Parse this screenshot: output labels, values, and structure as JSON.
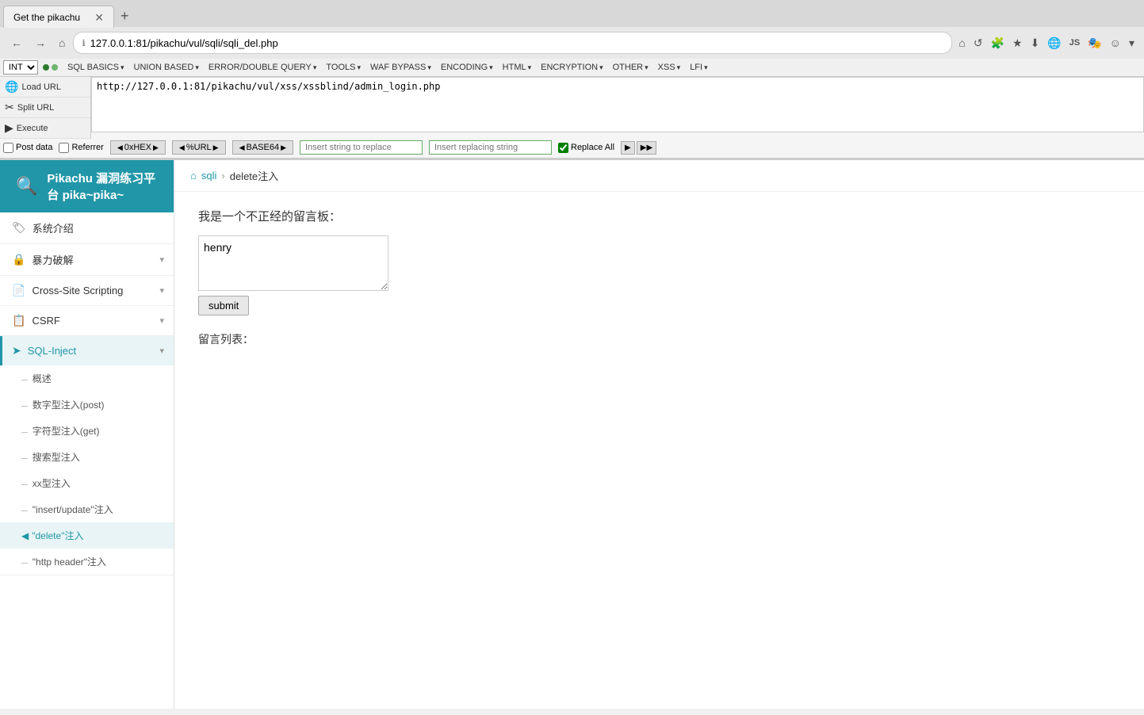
{
  "browser": {
    "tab_title": "Get the pikachu",
    "url": "127.0.0.1:81/pikachu/vul/sqli/sqli_del.php",
    "new_tab_label": "+"
  },
  "hackbar": {
    "int_label": "INT",
    "menu_items": [
      {
        "label": "SQL BASICS",
        "has_arrow": true
      },
      {
        "label": "UNION BASED",
        "has_arrow": true
      },
      {
        "label": "ERROR/DOUBLE QUERY",
        "has_arrow": true
      },
      {
        "label": "TOOLS",
        "has_arrow": true
      },
      {
        "label": "WAF BYPASS",
        "has_arrow": true
      },
      {
        "label": "ENCODING",
        "has_arrow": true
      },
      {
        "label": "HTML",
        "has_arrow": true
      },
      {
        "label": "ENCRYPTION",
        "has_arrow": true
      },
      {
        "label": "OTHER",
        "has_arrow": true
      },
      {
        "label": "XSS",
        "has_arrow": true
      },
      {
        "label": "LFI",
        "has_arrow": true
      }
    ],
    "url_value": "http://127.0.0.1:81/pikachu/vul/xss/xssblind/admin_login.php",
    "left_tools": [
      {
        "label": "Load URL",
        "icon": "🌐"
      },
      {
        "label": "Split URL",
        "icon": "✂"
      },
      {
        "label": "Execute",
        "icon": "▶"
      }
    ],
    "checkboxes": [
      {
        "label": "Post data",
        "checked": false
      },
      {
        "label": "Referrer",
        "checked": false
      }
    ],
    "encode_btns": [
      {
        "label": "0xHEX"
      },
      {
        "label": "%URL"
      },
      {
        "label": "BASE64"
      }
    ],
    "insert_string_placeholder": "Insert string to replace",
    "insert_replacing_placeholder": "Insert replacing string",
    "replace_all_label": "Replace All"
  },
  "app_header": {
    "icon": "🔍",
    "title": "Pikachu 漏洞练习平台 pika~pika~"
  },
  "sidebar": {
    "sections": [
      {
        "items": [
          {
            "label": "系统介绍",
            "icon": "🏷",
            "has_arrow": false,
            "indent": false
          }
        ]
      },
      {
        "items": [
          {
            "label": "暴力破解",
            "icon": "🔒",
            "has_arrow": true,
            "indent": false
          }
        ]
      },
      {
        "items": [
          {
            "label": "Cross-Site Scripting",
            "icon": "📄",
            "has_arrow": true,
            "indent": false
          }
        ]
      },
      {
        "items": [
          {
            "label": "CSRF",
            "icon": "📋",
            "has_arrow": true,
            "indent": false
          }
        ]
      },
      {
        "items": [
          {
            "label": "SQL-Inject",
            "icon": "➤",
            "has_arrow": true,
            "indent": false,
            "active": true
          },
          {
            "label": "概述",
            "sub": true
          },
          {
            "label": "数字型注入(post)",
            "sub": true
          },
          {
            "label": "字符型注入(get)",
            "sub": true
          },
          {
            "label": "搜索型注入",
            "sub": true
          },
          {
            "label": "xx型注入",
            "sub": true
          },
          {
            "label": "\"insert/update\"注入",
            "sub": true
          },
          {
            "label": "\"delete\"注入",
            "sub": true,
            "active_sub": true
          },
          {
            "label": "\"http header\"注入",
            "sub": true
          }
        ]
      }
    ]
  },
  "breadcrumb": {
    "home_icon": "🏠",
    "sqli_label": "sqli",
    "sep": "›",
    "current": "delete注入"
  },
  "main": {
    "form_label": "我是一个不正经的留言板：",
    "textarea_value": "henry",
    "submit_label": "submit",
    "comments_label": "留言列表："
  }
}
